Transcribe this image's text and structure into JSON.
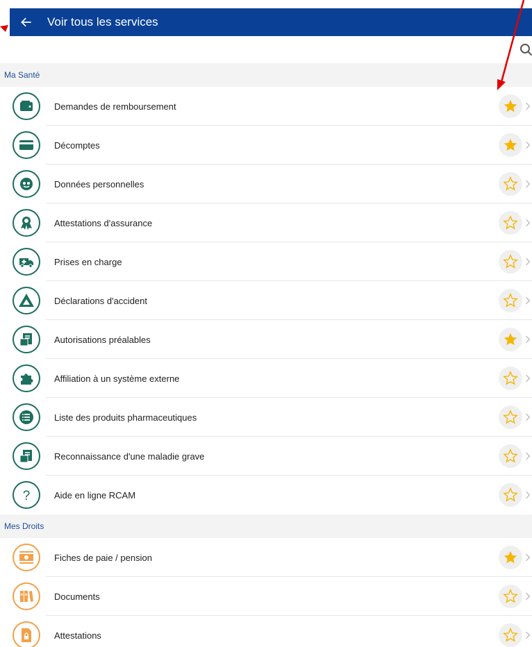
{
  "header": {
    "title": "Voir tous les services",
    "back_icon": "arrow-left-icon"
  },
  "search": {
    "icon": "search-icon"
  },
  "colors": {
    "header_bg": "#0a4196",
    "teal": "#1d6e5e",
    "orange": "#f2a14a",
    "star": "#f7b500",
    "section_text": "#1d4f9c",
    "annotation": "#e00000"
  },
  "sections": [
    {
      "title": "Ma Santé",
      "items": [
        {
          "label": "Demandes de remboursement",
          "icon": "wallet-icon",
          "favorite": true
        },
        {
          "label": "Décomptes",
          "icon": "card-icon",
          "favorite": true
        },
        {
          "label": "Données personnelles",
          "icon": "person-face-icon",
          "favorite": false
        },
        {
          "label": "Attestations d'assurance",
          "icon": "award-ribbon-icon",
          "favorite": false
        },
        {
          "label": "Prises en charge",
          "icon": "ambulance-icon",
          "favorite": false
        },
        {
          "label": "Déclarations d'accident",
          "icon": "warning-triangle-icon",
          "favorite": false
        },
        {
          "label": "Autorisations préalables",
          "icon": "document-icon",
          "favorite": true
        },
        {
          "label": "Affiliation à un système externe",
          "icon": "puzzle-icon",
          "favorite": false
        },
        {
          "label": "Liste des produits pharmaceutiques",
          "icon": "list-icon",
          "favorite": false
        },
        {
          "label": "Reconnaissance d'une maladie grave",
          "icon": "document-icon",
          "favorite": false
        },
        {
          "label": "Aide en ligne RCAM",
          "icon": "question-icon",
          "favorite": false
        }
      ]
    },
    {
      "title": "Mes Droits",
      "items": [
        {
          "label": "Fiches de paie / pension",
          "icon": "money-icon",
          "favorite": true
        },
        {
          "label": "Documents",
          "icon": "binders-icon",
          "favorite": false
        },
        {
          "label": "Attestations",
          "icon": "locked-document-icon",
          "favorite": false
        }
      ]
    }
  ]
}
